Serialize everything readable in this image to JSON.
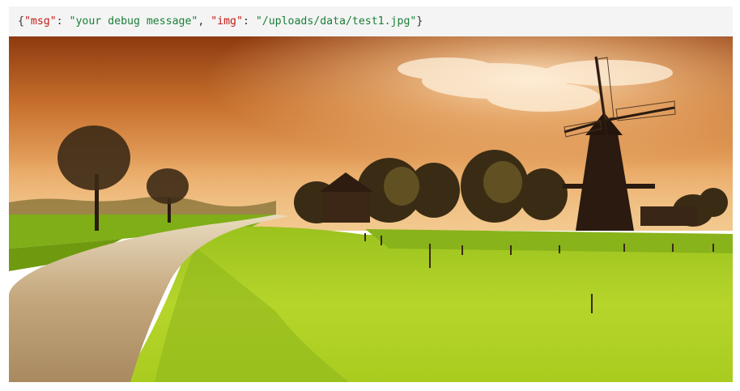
{
  "debug": {
    "open_brace": "{",
    "key1": "\"msg\"",
    "sep1": ": ",
    "val1": "\"your debug message\"",
    "comma": ", ",
    "key2": "\"img\"",
    "sep2": ": ",
    "val2": "\"/uploads/data/test1.jpg\"",
    "close_brace": "}"
  },
  "image": {
    "subject": "windmill-landscape",
    "colors": {
      "sky_top": "#9a3f10",
      "sky_mid": "#d98a3c",
      "sky_bottom": "#f3c58a",
      "grass": "#b7d22a",
      "grass_dark": "#6f9a10",
      "road": "#c9b48f",
      "silhouette": "#2a1a10"
    }
  }
}
